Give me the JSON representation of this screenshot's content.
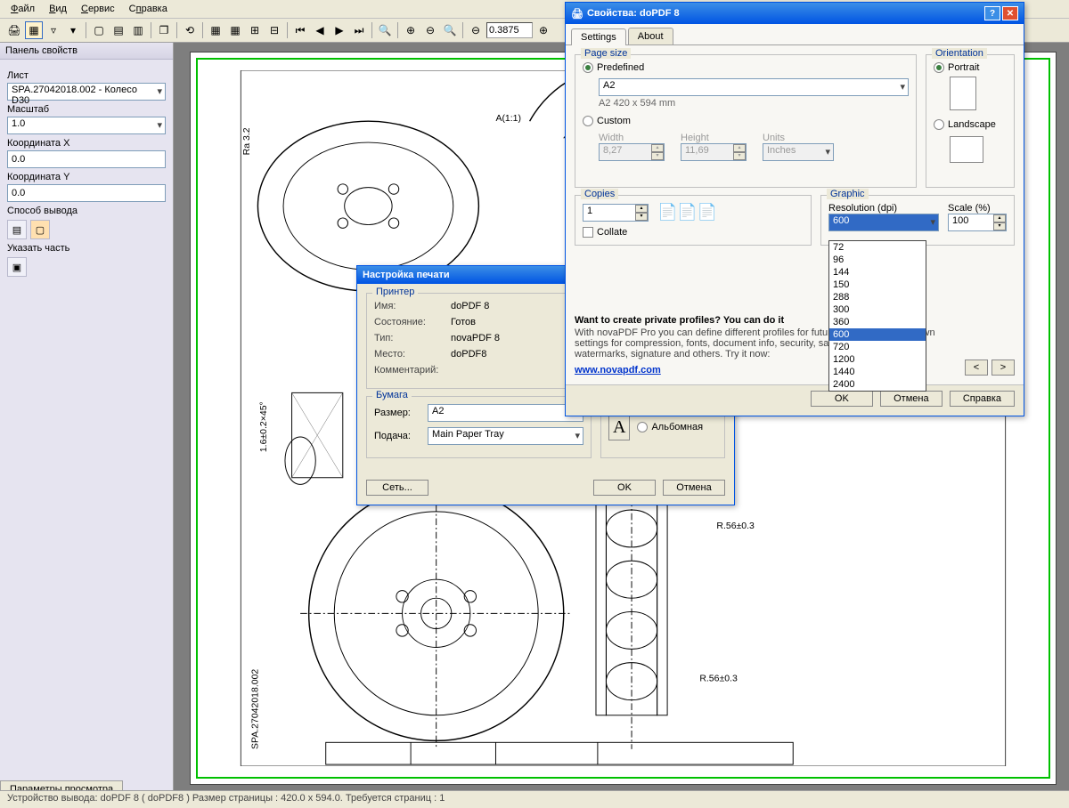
{
  "menubar": [
    "Файл",
    "Вид",
    "Сервис",
    "Справка"
  ],
  "toolbar": {
    "zoom": "0.3875"
  },
  "sidebar": {
    "title": "Панель свойств",
    "sheet_label": "Лист",
    "sheet_value": "SPA.27042018.002 - Колесо D30",
    "scale_label": "Масштаб",
    "scale_value": "1.0",
    "coordx_label": "Координата X",
    "coordx_value": "0.0",
    "coordy_label": "Координата Y",
    "coordy_value": "0.0",
    "output_label": "Способ вывода",
    "part_label": "Указать часть",
    "tab_bottom": "Параметры просмотра"
  },
  "statusbar": "Устройство вывода: doPDF 8 ( doPDF8 )   Размер страницы : 420.0 x 594.0.   Требуется страниц : 1",
  "print_dialog": {
    "title": "Настройка печати",
    "printer_legend": "Принтер",
    "name_label": "Имя:",
    "name_value": "doPDF 8",
    "state_label": "Состояние:",
    "state_value": "Готов",
    "type_label": "Тип:",
    "type_value": "novaPDF 8",
    "place_label": "Место:",
    "place_value": "doPDF8",
    "comment_label": "Комментарий:",
    "paper_legend": "Бумага",
    "size_label": "Размер:",
    "size_value": "A2",
    "feed_label": "Подача:",
    "feed_value": "Main Paper Tray",
    "landscape_label": "Альбомная",
    "network_btn": "Сеть...",
    "ok_btn": "OK",
    "cancel_btn": "Отмена"
  },
  "props_dialog": {
    "title": "Свойства: doPDF 8",
    "tab_settings": "Settings",
    "tab_about": "About",
    "page_size_legend": "Page size",
    "predefined_label": "Predefined",
    "predefined_value": "A2",
    "predefined_sub": "A2 420 x 594 mm",
    "custom_label": "Custom",
    "width_label": "Width",
    "width_value": "8,27",
    "height_label": "Height",
    "height_value": "11,69",
    "units_label": "Units",
    "units_value": "Inches",
    "orientation_legend": "Orientation",
    "portrait_label": "Portrait",
    "landscape_label": "Landscape",
    "copies_legend": "Copies",
    "copies_value": "1",
    "collate_label": "Collate",
    "graphic_legend": "Graphic",
    "resolution_label": "Resolution (dpi)",
    "resolution_value": "600",
    "scale_label": "Scale (%)",
    "scale_value": "100",
    "dpi_list": [
      "72",
      "96",
      "144",
      "150",
      "288",
      "300",
      "360",
      "600",
      "720",
      "1200",
      "1440",
      "2400"
    ],
    "promo_title": "Want to create private profiles? You can do it",
    "promo_body": "With novaPDF Pro you can define different profiles for future use, each with its own settings for compression, fonts, document info, security, save settings, page size, watermarks, signature and others. Try it now:",
    "promo_link": "www.novapdf.com",
    "prev_btn": "<",
    "next_btn": ">",
    "ok_btn": "OK",
    "cancel_btn": "Отмена",
    "help_btn": "Справка"
  }
}
